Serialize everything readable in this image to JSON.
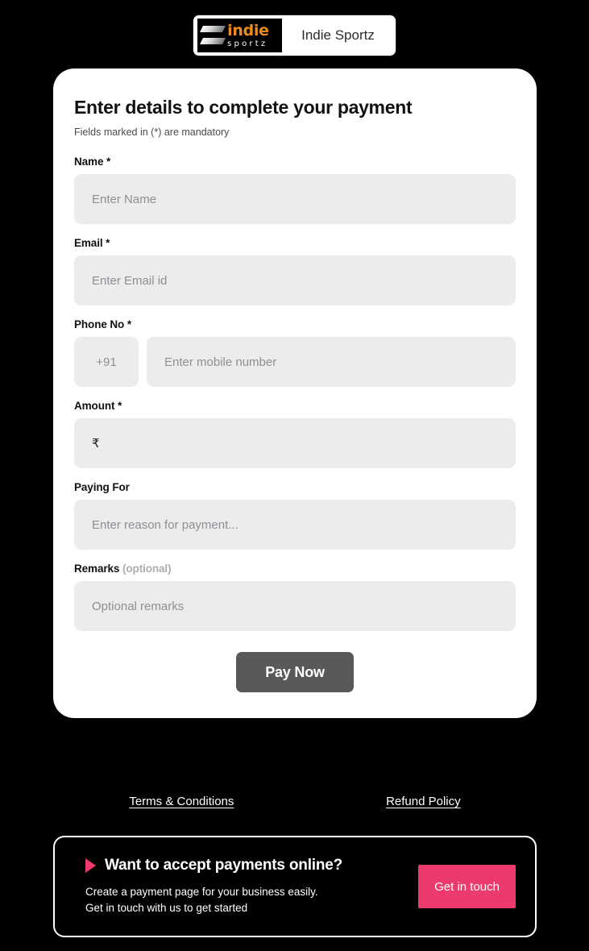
{
  "brand": {
    "logo_indie": "indie",
    "logo_sportz": "sportz",
    "name": "Indie Sportz",
    "logo_icon": "indie-sportz-logo"
  },
  "card": {
    "title": "Enter details to complete your payment",
    "subtitle": "Fields marked in (*) are mandatory",
    "fields": {
      "name": {
        "label": "Name *",
        "placeholder": "Enter Name",
        "value": ""
      },
      "email": {
        "label": "Email *",
        "placeholder": "Enter Email id",
        "value": ""
      },
      "phone": {
        "label": "Phone No *",
        "country_code": "+91",
        "placeholder": "Enter mobile number",
        "value": ""
      },
      "amount": {
        "label": "Amount *",
        "currency_symbol": "₹",
        "placeholder": "",
        "value": ""
      },
      "paying_for": {
        "label": "Paying For",
        "placeholder": "Enter reason for payment...",
        "value": ""
      },
      "remarks": {
        "label": "Remarks",
        "label_optional": "(optional)",
        "placeholder": "Optional remarks",
        "value": ""
      }
    },
    "pay_button": "Pay Now"
  },
  "footer": {
    "terms_link": "Terms & Conditions",
    "refund_link": "Refund Policy"
  },
  "promo": {
    "heading": "Want to accept payments online?",
    "line1": "Create a payment page for your business easily.",
    "line2": "Get in touch with us to get started",
    "button": "Get in touch"
  },
  "colors": {
    "background": "#000000",
    "card": "#ffffff",
    "input": "#ececec",
    "pay_button": "#595959",
    "accent_pink": "#ED3A6C",
    "logo_orange": "#F08A1E"
  }
}
